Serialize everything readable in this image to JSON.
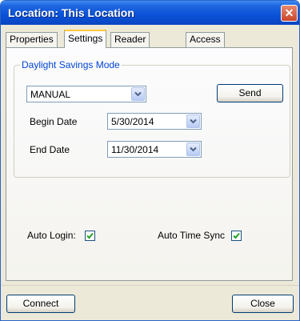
{
  "window": {
    "title": "Location: This Location",
    "close_glyph": "✕"
  },
  "tabs": [
    {
      "label": "Properties"
    },
    {
      "label": "Settings",
      "active": true
    },
    {
      "label": "Reader Groups"
    },
    {
      "label": "Access Groups"
    }
  ],
  "dst_group": {
    "label": "Daylight Savings Mode",
    "mode": {
      "value": "MANUAL"
    },
    "send_label": "Send",
    "begin": {
      "label": "Begin Date",
      "value": "5/30/2014"
    },
    "end": {
      "label": "End Date",
      "value": "11/30/2014"
    }
  },
  "options": {
    "auto_login": {
      "label": "Auto Login:",
      "checked": true
    },
    "auto_time_sync": {
      "label": "Auto Time Sync",
      "checked": true
    }
  },
  "footer": {
    "connect_label": "Connect",
    "close_label": "Close"
  },
  "colors": {
    "title_bar": "#0a52d8",
    "group_label": "#0046d5",
    "check_mark": "#21a121",
    "active_tab_accent": "#ffc83c"
  }
}
